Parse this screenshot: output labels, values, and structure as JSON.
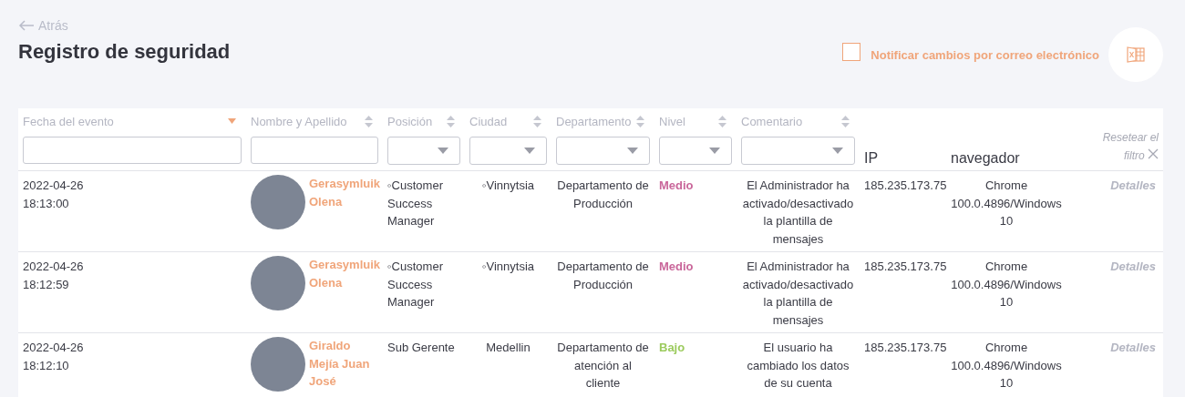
{
  "back_link": {
    "label": "Atrás"
  },
  "title": "Registro de seguridad",
  "notify": {
    "label": "Notificar cambios por correo electrónico",
    "checked": false
  },
  "table": {
    "columns": [
      {
        "label": "Fecha del evento",
        "sorted": true,
        "kind": "text"
      },
      {
        "label": "Nombre y Apellido",
        "sorted": false,
        "kind": "text"
      },
      {
        "label": "Posición",
        "sorted": false,
        "kind": "select"
      },
      {
        "label": "Ciudad",
        "sorted": false,
        "kind": "select"
      },
      {
        "label": "Departamento",
        "sorted": false,
        "kind": "select"
      },
      {
        "label": "Nivel",
        "sorted": false,
        "kind": "select"
      },
      {
        "label": "Comentario",
        "sorted": false,
        "kind": "select"
      },
      {
        "label": "IP",
        "kind": "plain"
      },
      {
        "label": "navegador",
        "kind": "plain"
      }
    ],
    "reset_filter": "Resetear el filtro",
    "rows": [
      {
        "date": "2022-04-26",
        "time": "18:13:00",
        "name": "Gerasymluik Olena",
        "position": "◦Customer Success Manager",
        "city": "◦Vinnytsia",
        "department": "Departamento de Producción",
        "level": "Medio",
        "color": "#c9669a",
        "comment": "El Administrador ha activado/desactivado la plantilla de mensajes",
        "ip": "185.235.173.75",
        "browser": "Chrome 100.0.4896/Windows 10",
        "action": "Detalles"
      },
      {
        "date": "2022-04-26",
        "time": "18:12:59",
        "name": "Gerasymluik Olena",
        "position": "◦Customer Success Manager",
        "city": "◦Vinnytsia",
        "department": "Departamento de Producción",
        "level": "Medio",
        "color": "#c9669a",
        "comment": "El Administrador ha activado/desactivado la plantilla de mensajes",
        "ip": "185.235.173.75",
        "browser": "Chrome 100.0.4896/Windows 10",
        "action": "Detalles"
      },
      {
        "date": "2022-04-26",
        "time": "18:12:10",
        "name": "Giraldo Mejía Juan José",
        "position": "Sub Gerente",
        "city": "Medellin",
        "department": "Departamento de atención al cliente",
        "level": "Bajo",
        "color": "#9ccb5e",
        "comment": "El usuario ha cambiado los datos de su cuenta",
        "ip": "185.235.173.75",
        "browser": "Chrome 100.0.4896/Windows 10",
        "action": "Detalles"
      }
    ]
  }
}
